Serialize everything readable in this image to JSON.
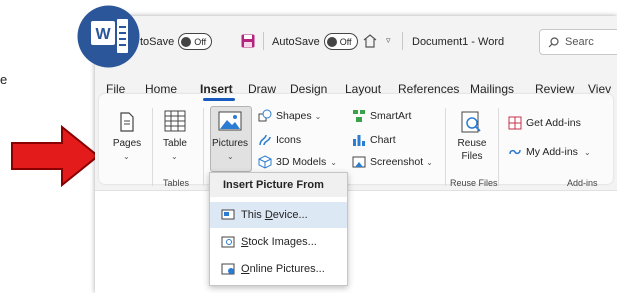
{
  "window": {
    "autosave_partial": "toSave",
    "autosave_toggle_1": "Off",
    "autosave_label": "AutoSave",
    "autosave_toggle_2": "Off",
    "document_title": "Document1  -  Word",
    "search_placeholder": "Searc"
  },
  "tabs": [
    "File",
    "Home",
    "Insert",
    "Draw",
    "Design",
    "Layout",
    "References",
    "Mailings",
    "Review",
    "Viev"
  ],
  "ribbon": {
    "pages": {
      "label": "Pages"
    },
    "table": {
      "label": "Table",
      "group": "Tables"
    },
    "pictures": {
      "label": "Pictures"
    },
    "shapes": "Shapes",
    "icons": "Icons",
    "models3d": "3D Models",
    "smartart": "SmartArt",
    "chart": "Chart",
    "screenshot": "Screenshot",
    "illustrations_group": "s",
    "reuse": {
      "line1": "Reuse",
      "line2": "Files",
      "group": "Reuse Files"
    },
    "get_addins": "Get Add-ins",
    "my_addins": "My Add-ins",
    "addins_group": "Add-ins"
  },
  "menu": {
    "header": "Insert Picture From",
    "items": [
      {
        "pre": "This ",
        "u": "D",
        "post": "evice..."
      },
      {
        "pre": "",
        "u": "S",
        "post": "tock Images..."
      },
      {
        "pre": "",
        "u": "O",
        "post": "nline Pictures..."
      }
    ]
  },
  "clipped_text": "e",
  "colors": {
    "accent": "#185abd",
    "arrow": "#e00000",
    "word_blue": "#2b579a"
  }
}
